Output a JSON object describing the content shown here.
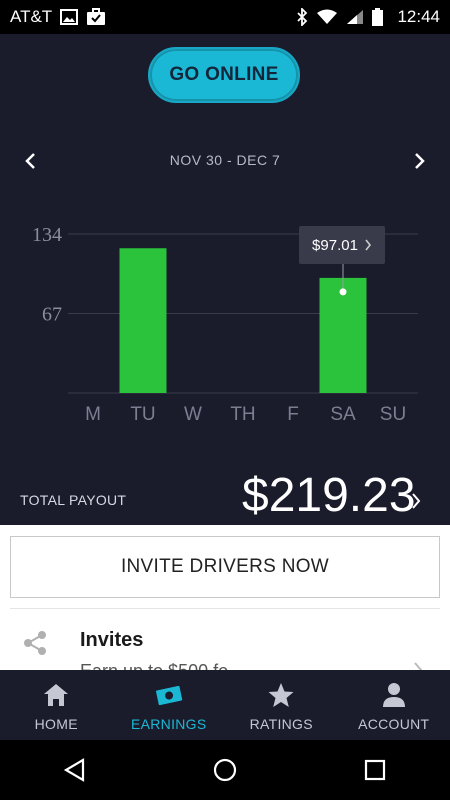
{
  "status_bar": {
    "carrier": "AT&T",
    "time": "12:44",
    "icons": [
      "image-icon",
      "briefcase-check-icon",
      "bluetooth-icon",
      "wifi-icon",
      "signal-icon",
      "battery-icon"
    ]
  },
  "go_online": {
    "label": "GO ONLINE"
  },
  "week": {
    "label": "NOV 30 - DEC 7"
  },
  "chart_data": {
    "type": "bar",
    "categories": [
      "M",
      "TU",
      "W",
      "TH",
      "F",
      "SA",
      "SU"
    ],
    "values": [
      0,
      122,
      0,
      0,
      0,
      97.01,
      0
    ],
    "yticks": [
      67,
      134
    ],
    "ylim": [
      0,
      134
    ],
    "highlighted": "SA",
    "tooltip": "$97.01",
    "colors": {
      "TH": "#237a37",
      "SA": "#2bc23c",
      "grid": "#3a3c4d"
    }
  },
  "total": {
    "label": "TOTAL PAYOUT",
    "amount": "$219.23"
  },
  "invite_button": {
    "label": "INVITE DRIVERS NOW"
  },
  "invites": {
    "title": "Invites",
    "subtitle": "Earn up to $500 fo"
  },
  "nav": [
    {
      "label": "HOME",
      "icon": "home-icon"
    },
    {
      "label": "EARNINGS",
      "icon": "earnings-icon",
      "active": true
    },
    {
      "label": "RATINGS",
      "icon": "star-icon"
    },
    {
      "label": "ACCOUNT",
      "icon": "account-icon"
    }
  ],
  "colors": {
    "accent": "#1bb8d6",
    "background": "#1a1b2b"
  }
}
